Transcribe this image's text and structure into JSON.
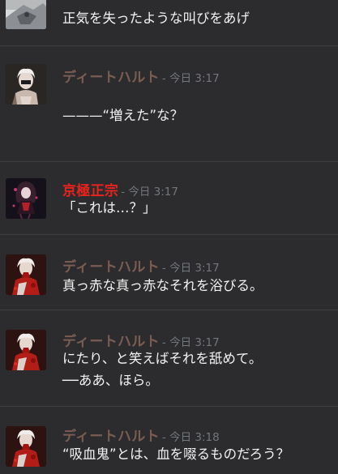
{
  "colors": {
    "background": "#2c2c2e",
    "author_diethard": "#7a5d52",
    "author_kyogoku": "#e6231c",
    "timestamp": "#72767d",
    "divider": "#3d3d40"
  },
  "messages": [
    {
      "avatar": "grey-armored-character-avatar",
      "author": "",
      "timestamp": "",
      "lines": [
        "正気を失ったような叫びをあげ"
      ]
    },
    {
      "avatar": "white-haired-character-avatar",
      "author": "ディートハルト",
      "timestamp": "- 今日 3:17",
      "lines": [
        "———“増えた”な？"
      ]
    },
    {
      "avatar": "red-haired-character-avatar",
      "author": "京極正宗",
      "timestamp": "- 今日 3:17",
      "lines": [
        "「これは…？」"
      ]
    },
    {
      "avatar": "bloody-white-haired-character-avatar",
      "author": "ディートハルト",
      "timestamp": "- 今日 3:17",
      "lines": [
        "真っ赤な真っ赤なそれを浴びる。"
      ]
    },
    {
      "avatar": "bloody-white-haired-character-avatar",
      "author": "ディートハルト",
      "timestamp": "- 今日 3:17",
      "lines": [
        "にたり、と笑えばそれを舐めて。",
        "──ああ、ほら。"
      ]
    },
    {
      "avatar": "bloody-white-haired-character-avatar",
      "author": "ディートハルト",
      "timestamp": "- 今日 3:18",
      "lines": [
        "“吸血鬼”とは、血を啜るものだろう？"
      ]
    }
  ]
}
